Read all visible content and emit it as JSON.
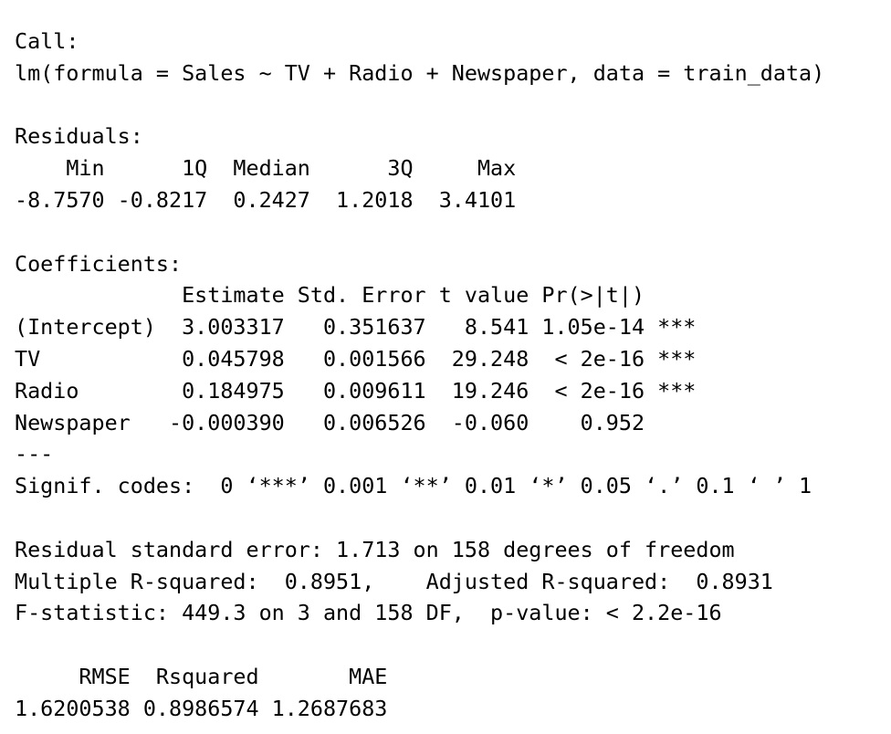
{
  "output": {
    "call_header": "Call:",
    "call": "lm(formula = Sales ~ TV + Radio + Newspaper, data = train_data)",
    "residuals_header": "Residuals:",
    "residuals_labels": "    Min      1Q  Median      3Q     Max ",
    "residuals_values": "-8.7570 -0.8217  0.2427  1.2018  3.4101 ",
    "coefficients_header": "Coefficients:",
    "coef_col_header": "             Estimate Std. Error t value Pr(>|t|)    ",
    "coef_rows": [
      "(Intercept)  3.003317   0.351637   8.541 1.05e-14 ***",
      "TV           0.045798   0.001566  29.248  < 2e-16 ***",
      "Radio        0.184975   0.009611  19.246  < 2e-16 ***",
      "Newspaper   -0.000390   0.006526  -0.060    0.952    "
    ],
    "separator": "---",
    "signif_codes": "Signif. codes:  0 ‘***’ 0.001 ‘**’ 0.01 ‘*’ 0.05 ‘.’ 0.1 ‘ ’ 1",
    "residual_se": "Residual standard error: 1.713 on 158 degrees of freedom",
    "r_squared": "Multiple R-squared:  0.8951,\tAdjusted R-squared:  0.8931 ",
    "f_statistic": "F-statistic: 449.3 on 3 and 158 DF,  p-value: < 2.2e-16",
    "metrics_labels": "     RMSE  Rsquared       MAE ",
    "metrics_values": "1.6200538 0.8986574 1.2687683 "
  }
}
